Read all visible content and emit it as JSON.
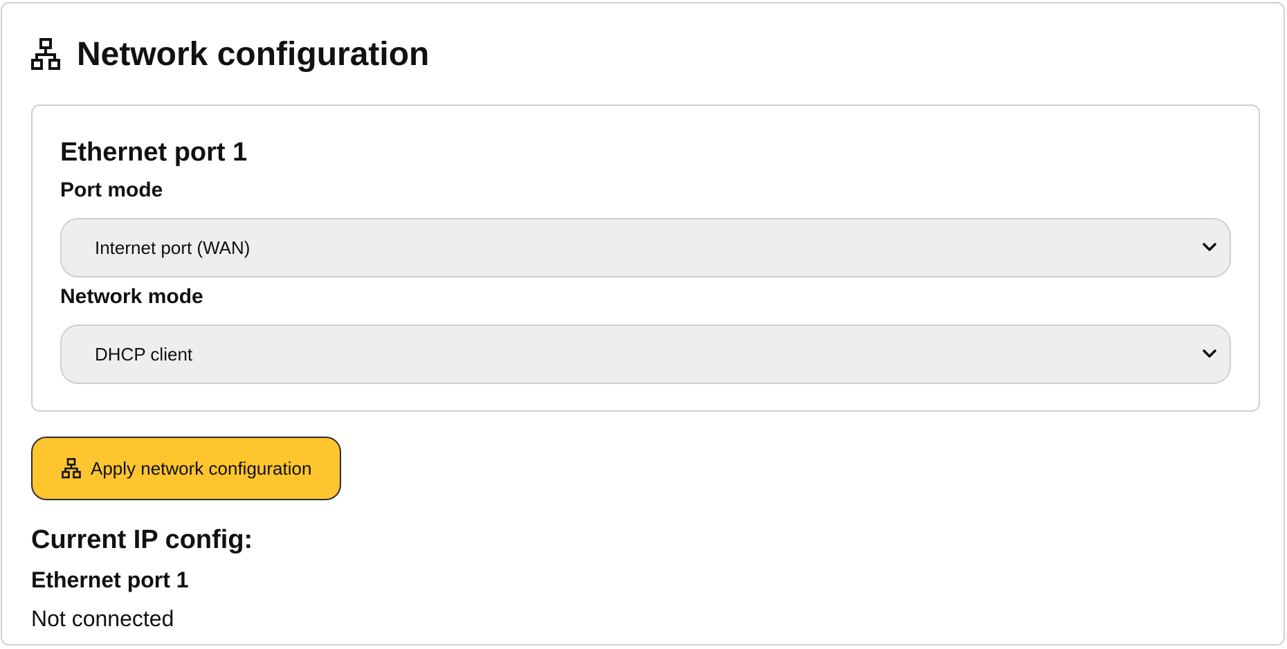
{
  "header": {
    "title": "Network configuration",
    "icon": "network-icon"
  },
  "ethernet_card": {
    "title": "Ethernet port 1",
    "port_mode": {
      "label": "Port mode",
      "selected": "Internet port (WAN)"
    },
    "network_mode": {
      "label": "Network mode",
      "selected": "DHCP client"
    }
  },
  "apply_button": {
    "label": "Apply network configuration",
    "icon": "network-icon",
    "color": "#fec52e"
  },
  "current_ip": {
    "title": "Current IP config:",
    "port_name": "Ethernet port 1",
    "status": "Not connected"
  }
}
